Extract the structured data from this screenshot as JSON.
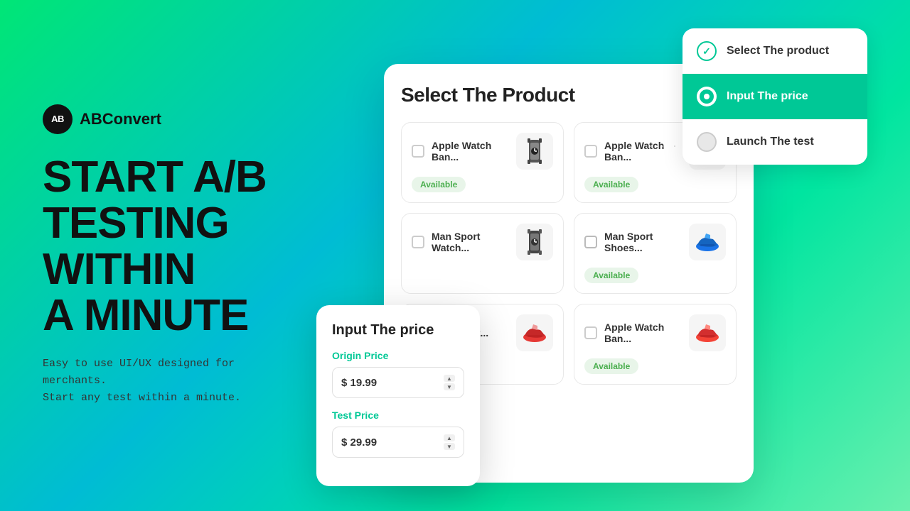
{
  "logo": {
    "icon_text": "AB",
    "name": "ABConvert"
  },
  "headline": "START A/B\nTESTING\nWITHIN\nA MINUTE",
  "subtitle": "Easy to use UI/UX designed for merchants.\nStart any test within a minute.",
  "main_card": {
    "title": "Select The  Product",
    "products": [
      {
        "id": 1,
        "name": "Apple Watch Ban...",
        "status": "Available",
        "icon": "⌚",
        "icon_color": "#555"
      },
      {
        "id": 2,
        "name": "Apple Watch Ban...",
        "status": "Available",
        "icon": "⌚",
        "icon_color": "#333"
      },
      {
        "id": 3,
        "name": "Man Sport Watch...",
        "status": null,
        "icon": "⌚",
        "icon_color": "#444"
      },
      {
        "id": 4,
        "name": "Man Sport Shoes...",
        "status": "Available",
        "icon": "👟",
        "icon_color": "#1a73e8"
      },
      {
        "id": 5,
        "name": "Man Sport...",
        "status": null,
        "icon": "👟",
        "icon_color": "#e53935"
      },
      {
        "id": 6,
        "name": "Apple Watch Ban...",
        "status": "Available",
        "icon": "👟",
        "icon_color": "#e53935"
      }
    ]
  },
  "price_popup": {
    "title": "Input The price",
    "origin_label": "Origin Price",
    "origin_value": "$ 19.99",
    "test_label": "Test Price",
    "test_value": "$ 29.99"
  },
  "steps": [
    {
      "id": 1,
      "label": "Select The product",
      "state": "completed"
    },
    {
      "id": 2,
      "label": "Input The price",
      "state": "active"
    },
    {
      "id": 3,
      "label": "Launch The test",
      "state": "inactive"
    }
  ],
  "colors": {
    "accent": "#00c896",
    "text_dark": "#111111",
    "badge_green": "#4caf50",
    "badge_bg": "#e8f5e9"
  }
}
